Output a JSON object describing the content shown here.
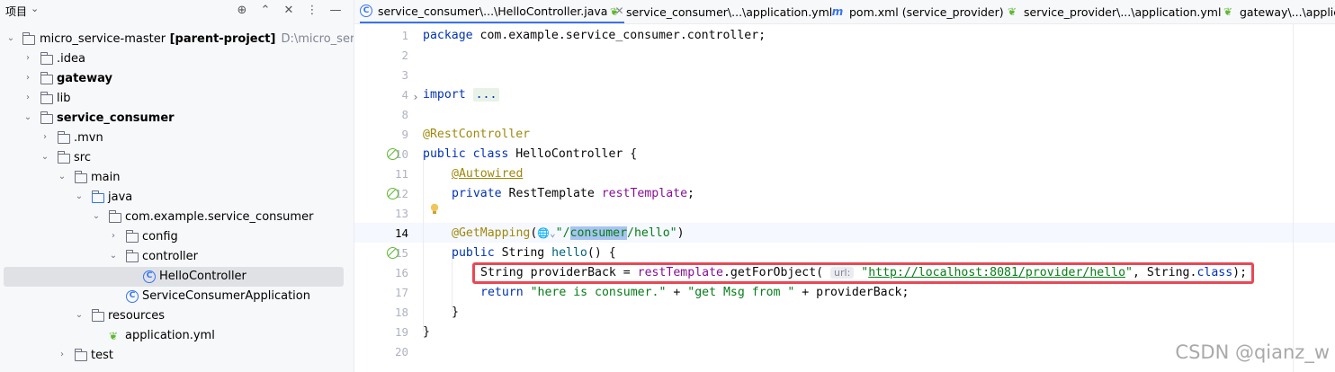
{
  "project_panel": {
    "title": "项目",
    "chevron": "⌄",
    "tree": [
      {
        "label": "micro_service-master",
        "suffix": " [parent-project]",
        "path": "D:\\micro_service-",
        "bold": false
      },
      {
        "label": ".idea"
      },
      {
        "label": "gateway",
        "bold": true
      },
      {
        "label": "lib"
      },
      {
        "label": "service_consumer",
        "bold": true
      },
      {
        "label": ".mvn"
      },
      {
        "label": "src"
      },
      {
        "label": "main"
      },
      {
        "label": "java"
      },
      {
        "label": "com.example.service_consumer"
      },
      {
        "label": "config"
      },
      {
        "label": "controller"
      },
      {
        "label": "HelloController"
      },
      {
        "label": "ServiceConsumerApplication"
      },
      {
        "label": "resources"
      },
      {
        "label": "application.yml"
      },
      {
        "label": "test"
      }
    ]
  },
  "tabs": [
    {
      "label": "service_consumer\\...\\HelloController.java",
      "icon": "class-icon",
      "active": true
    },
    {
      "label": "service_consumer\\...\\application.yml",
      "icon": "yaml-icon"
    },
    {
      "label": "pom.xml (service_provider)",
      "icon": "maven-icon"
    },
    {
      "label": "service_provider\\...\\application.yml",
      "icon": "yaml-icon"
    },
    {
      "label": "gateway\\...\\applica",
      "icon": "yaml-icon"
    }
  ],
  "editor": {
    "line_numbers": [
      "1",
      "2",
      "3",
      "4",
      "8",
      "9",
      "10",
      "11",
      "12",
      "13",
      "14",
      "15",
      "16",
      "17",
      "18",
      "19",
      "20"
    ],
    "current_line": "14",
    "lines": {
      "l1_kw": "package",
      "l1_rest": " com.example.service_consumer.controller;",
      "l4_kw": "import",
      "l4_fold": "...",
      "l9": "@RestController",
      "l10_kw1": "public",
      "l10_kw2": "class",
      "l10_rest": " HelloController {",
      "l11": "@Autowired",
      "l12_kw": "private",
      "l12_type": " RestTemplate ",
      "l12_fld": "restTemplate",
      "l12_end": ";",
      "l14_an": "@GetMapping",
      "l14_open": "(",
      "l14_icons": "🌐⌄",
      "l14_q1": "\"/",
      "l14_hl": "consumer",
      "l14_q2": "/hello\"",
      "l14_close": ")",
      "l15_kw": "public",
      "l15_rest": " String ",
      "l15_m": "hello",
      "l15_end": "() {",
      "l16_a": "String providerBack = ",
      "l16_fld": "restTemplate",
      "l16_b": ".getForObject( ",
      "l16_hint": "url:",
      "l16_q1": " \"",
      "l16_url": "http://localhost:8081/provider/hello",
      "l16_q2": "\"",
      "l16_c": ", String.",
      "l16_kw": "class",
      "l16_d": ");",
      "l17_kw": "return",
      "l17_s1": " \"here is consumer.\"",
      "l17_p1": " + ",
      "l17_s2": "\"get Msg from \"",
      "l17_p2": " + providerBack;",
      "l18": "}",
      "l19": "}"
    }
  },
  "watermark": "CSDN @qianz_w",
  "colors": {
    "keyword": "#0033b3",
    "annotation": "#9e880d",
    "string": "#067d17",
    "field": "#871094",
    "highlight_box": "#e84855"
  }
}
